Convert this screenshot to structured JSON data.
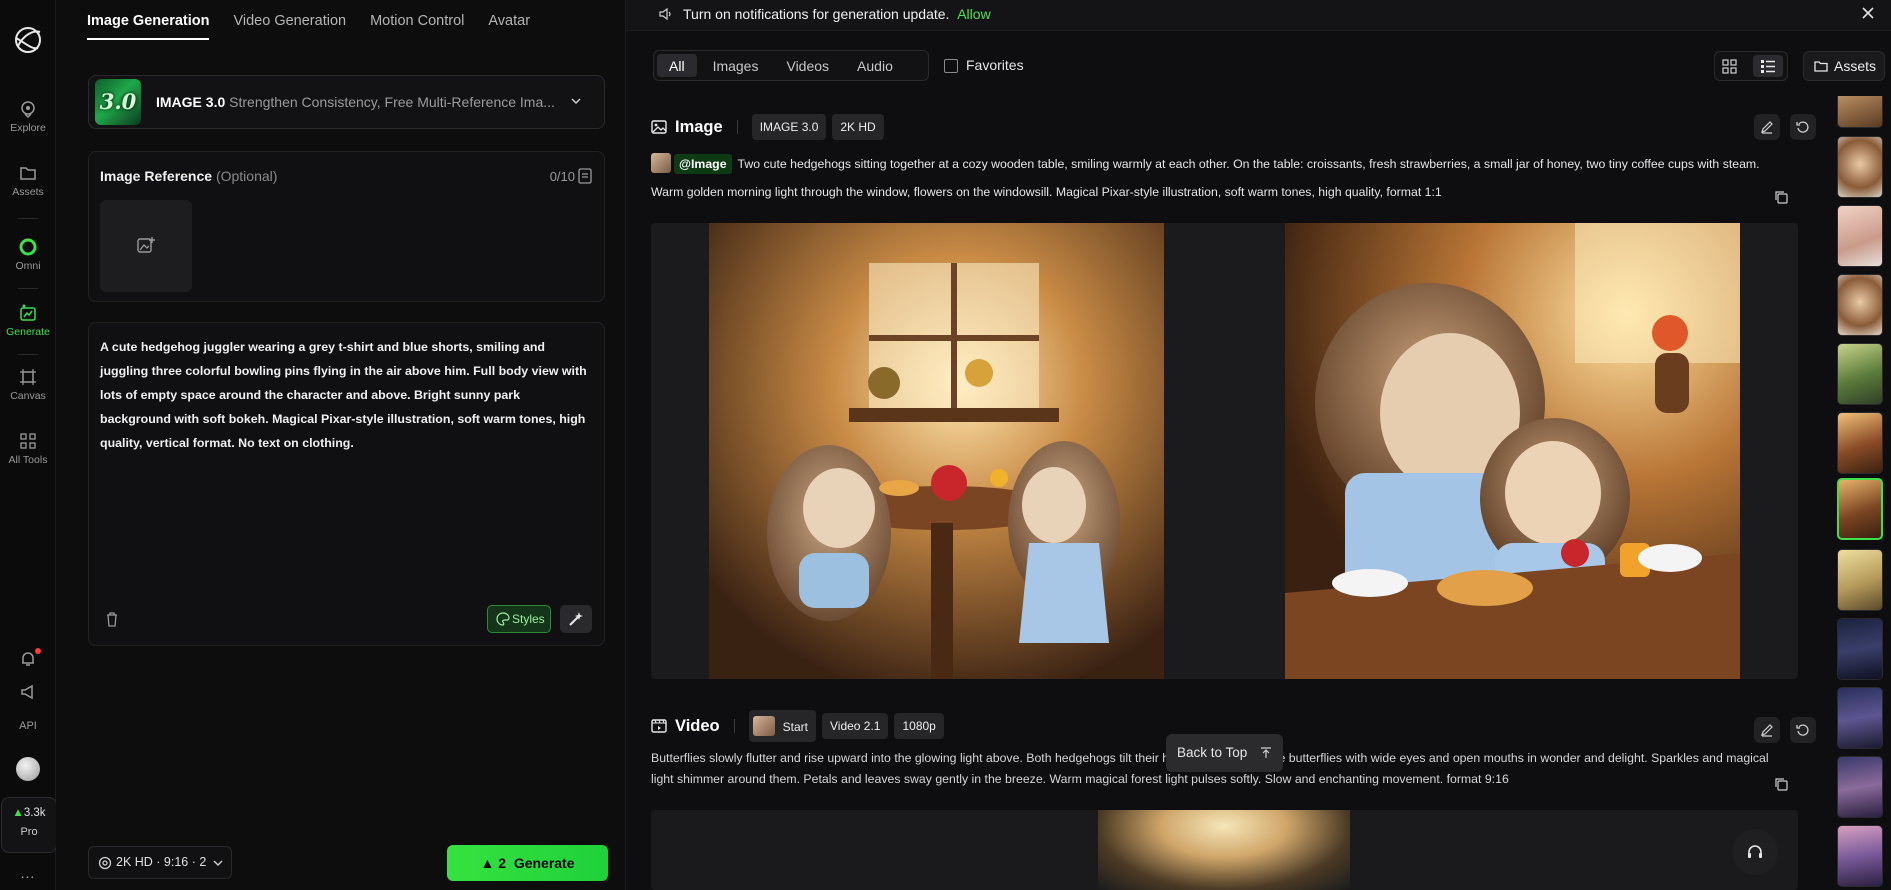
{
  "rail": {
    "items": [
      {
        "label": "Explore",
        "icon": "explore-icon"
      },
      {
        "label": "Assets",
        "icon": "folder-icon"
      },
      {
        "label": "Omni",
        "icon": "omni-ring-icon"
      },
      {
        "label": "Generate",
        "icon": "generate-icon",
        "active": true
      },
      {
        "label": "Canvas",
        "icon": "canvas-icon"
      },
      {
        "label": "All Tools",
        "icon": "grid-icon"
      }
    ],
    "api_label": "API",
    "credits": "3.3k",
    "plan": "Pro",
    "more": "..."
  },
  "left": {
    "tabs": [
      "Image Generation",
      "Video Generation",
      "Motion Control",
      "Avatar"
    ],
    "active_tab": 0,
    "model": {
      "badge": "3.0",
      "name": "IMAGE 3.0",
      "description": "Strengthen Consistency, Free Multi-Reference Ima..."
    },
    "reference": {
      "title": "Image Reference",
      "optional": "(Optional)",
      "count": "0/10"
    },
    "prompt": "A cute hedgehog juggler wearing a grey t-shirt and blue shorts, smiling and juggling three colorful bowling pins flying in the air above him. Full body view with lots of empty space around the character and above. Bright sunny park background with soft bokeh. Magical Pixar-style illustration, soft warm tones, high quality, vertical format. No text on clothing.",
    "styles_label": "Styles",
    "settings_label": "2K HD · 9:16 · 2",
    "generate": {
      "cost": "2",
      "label": "Generate"
    }
  },
  "notification": {
    "text": "Turn on notifications for generation update.",
    "action": "Allow"
  },
  "filters": {
    "options": [
      "All",
      "Images",
      "Videos",
      "Audio"
    ],
    "active": 0,
    "favorites_label": "Favorites"
  },
  "assets_label": "Assets",
  "feed": {
    "image_section": {
      "title": "Image",
      "chips": [
        "IMAGE 3.0",
        "2K HD"
      ],
      "tag": "@Image",
      "prompt": "Two cute hedgehogs sitting together at a cozy wooden table, smiling warmly at each other. On the table: croissants, fresh strawberries, a small jar of honey, two tiny coffee cups with steam. Warm golden morning light through the window, flowers on the windowsill. Magical Pixar-style illustration, soft warm tones, high quality, format 1:1"
    },
    "video_section": {
      "title": "Video",
      "chips": [
        "Start",
        "Video 2.1",
        "1080p"
      ],
      "prompt": "Butterflies slowly flutter and rise upward into the glowing light above. Both hedgehogs tilt their heads up watching the butterflies with wide eyes and open mouths in wonder and delight. Sparkles and magical light shimmer around them. Petals and leaves sway gently in the breeze. Warm magical forest light pulses softly. Slow and enchanting movement. format 9:16"
    },
    "back_to_top": "Back to Top"
  },
  "colors": {
    "accent": "#3fe04a",
    "background": "#0d0d0e",
    "panel": "#101012"
  }
}
